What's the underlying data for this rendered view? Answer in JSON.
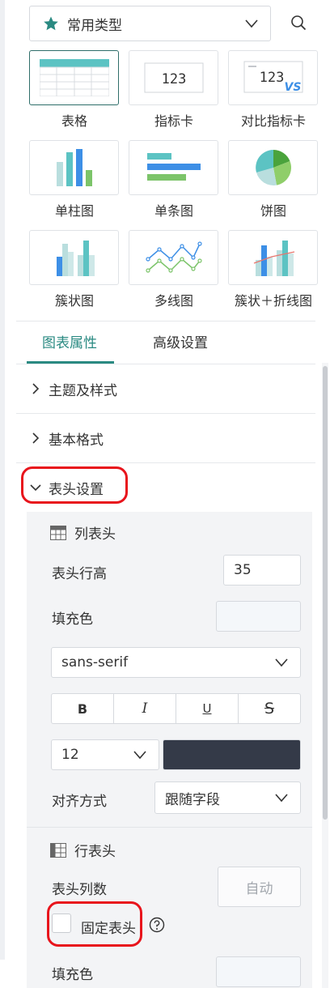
{
  "type_selector": {
    "label": "常用类型",
    "icon": "star-icon"
  },
  "chart_types": [
    {
      "label": "表格",
      "icon": "table-chart-icon",
      "selected": true
    },
    {
      "label": "指标卡",
      "icon": "kpi-card-icon",
      "number": "123"
    },
    {
      "label": "对比指标卡",
      "icon": "compare-kpi-card-icon",
      "number": "123",
      "badge": "VS"
    },
    {
      "label": "单柱图",
      "icon": "single-column-chart-icon"
    },
    {
      "label": "单条图",
      "icon": "single-bar-chart-icon"
    },
    {
      "label": "饼图",
      "icon": "pie-chart-icon"
    },
    {
      "label": "簇状图",
      "icon": "clustered-column-chart-icon"
    },
    {
      "label": "多线图",
      "icon": "multi-line-chart-icon"
    },
    {
      "label": "簇状＋折线图",
      "icon": "clustered-line-combo-chart-icon"
    }
  ],
  "tabs": [
    {
      "label": "图表属性",
      "active": true
    },
    {
      "label": "高级设置",
      "active": false
    }
  ],
  "sections": {
    "theme": "主题及样式",
    "basic_format": "基本格式",
    "header_settings": "表头设置"
  },
  "column_header": {
    "title": "列表头",
    "row_height_label": "表头行高",
    "row_height_value": "35",
    "fill_color_label": "填充色",
    "font_family": "sans-serif",
    "style_buttons": [
      "B",
      "I",
      "U",
      "S"
    ],
    "font_size": "12",
    "font_color": "#343a48",
    "align_label": "对齐方式",
    "align_value": "跟随字段"
  },
  "row_header": {
    "title": "行表头",
    "column_count_label": "表头列数",
    "column_count_value": "自动",
    "freeze_label": "固定表头",
    "fill_color_label": "填充色"
  },
  "colors": {
    "accent": "#2a8a82",
    "highlight_outline": "#e8141c",
    "bar_blue": "#3d8fe6",
    "bar_teal": "#5cc3c3",
    "bar_green": "#7cc46a"
  }
}
